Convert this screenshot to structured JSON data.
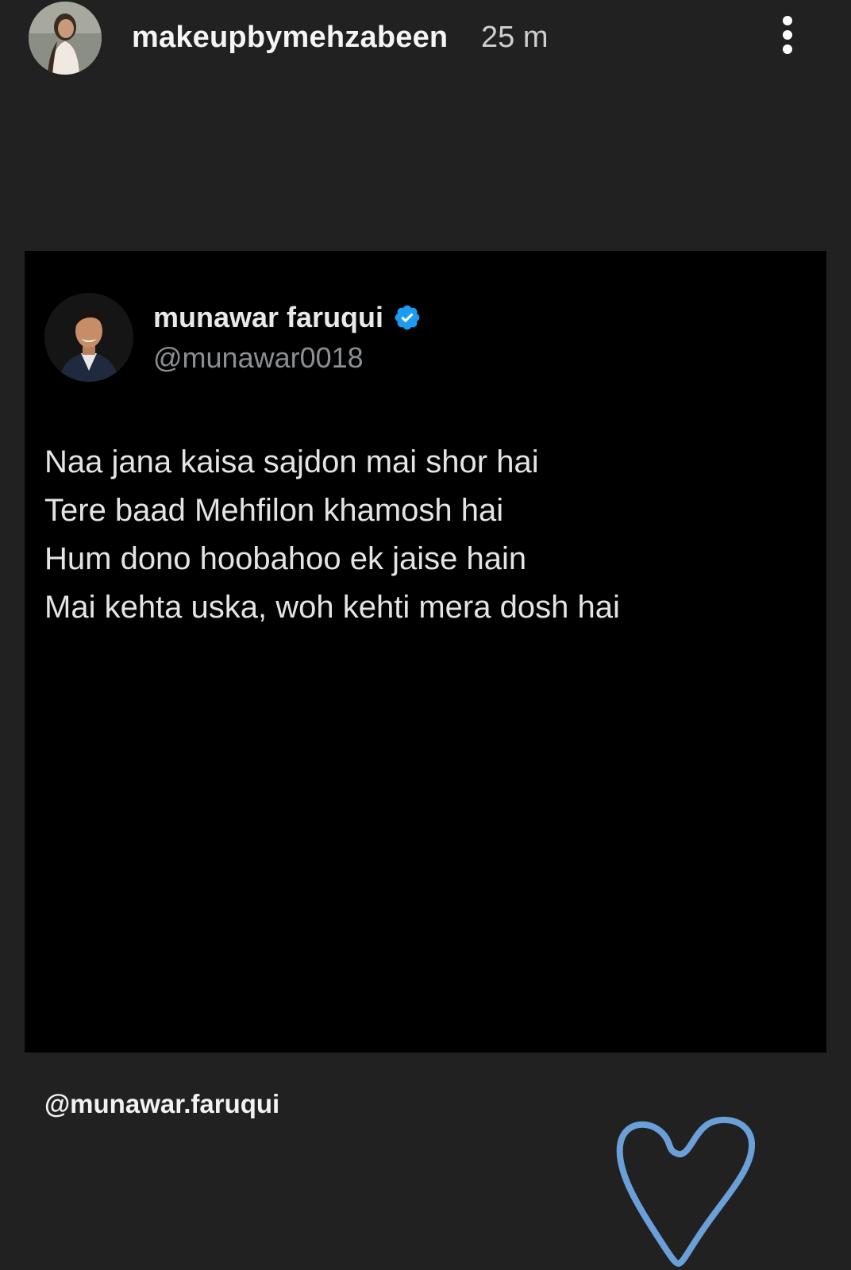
{
  "story_header": {
    "username": "makeupbymehzabeen",
    "time_ago": "25 m",
    "more_icon": "vertical-ellipsis-icon"
  },
  "tweet": {
    "author_name": "munawar faruqui",
    "handle": "@munawar0018",
    "verified_icon": "verified-badge-icon",
    "verified_color": "#1d9bf0",
    "lines": [
      "Naa jana kaisa sajdon mai shor hai",
      "Tere baad Mehfilon khamosh hai",
      "Hum dono hoobahoo ek jaise hain",
      "Mai kehta uska, woh kehti mera dosh hai"
    ]
  },
  "mention": "@munawar.faruqui",
  "sticker": {
    "icon": "heart-icon",
    "color": "#6a9fd8"
  }
}
